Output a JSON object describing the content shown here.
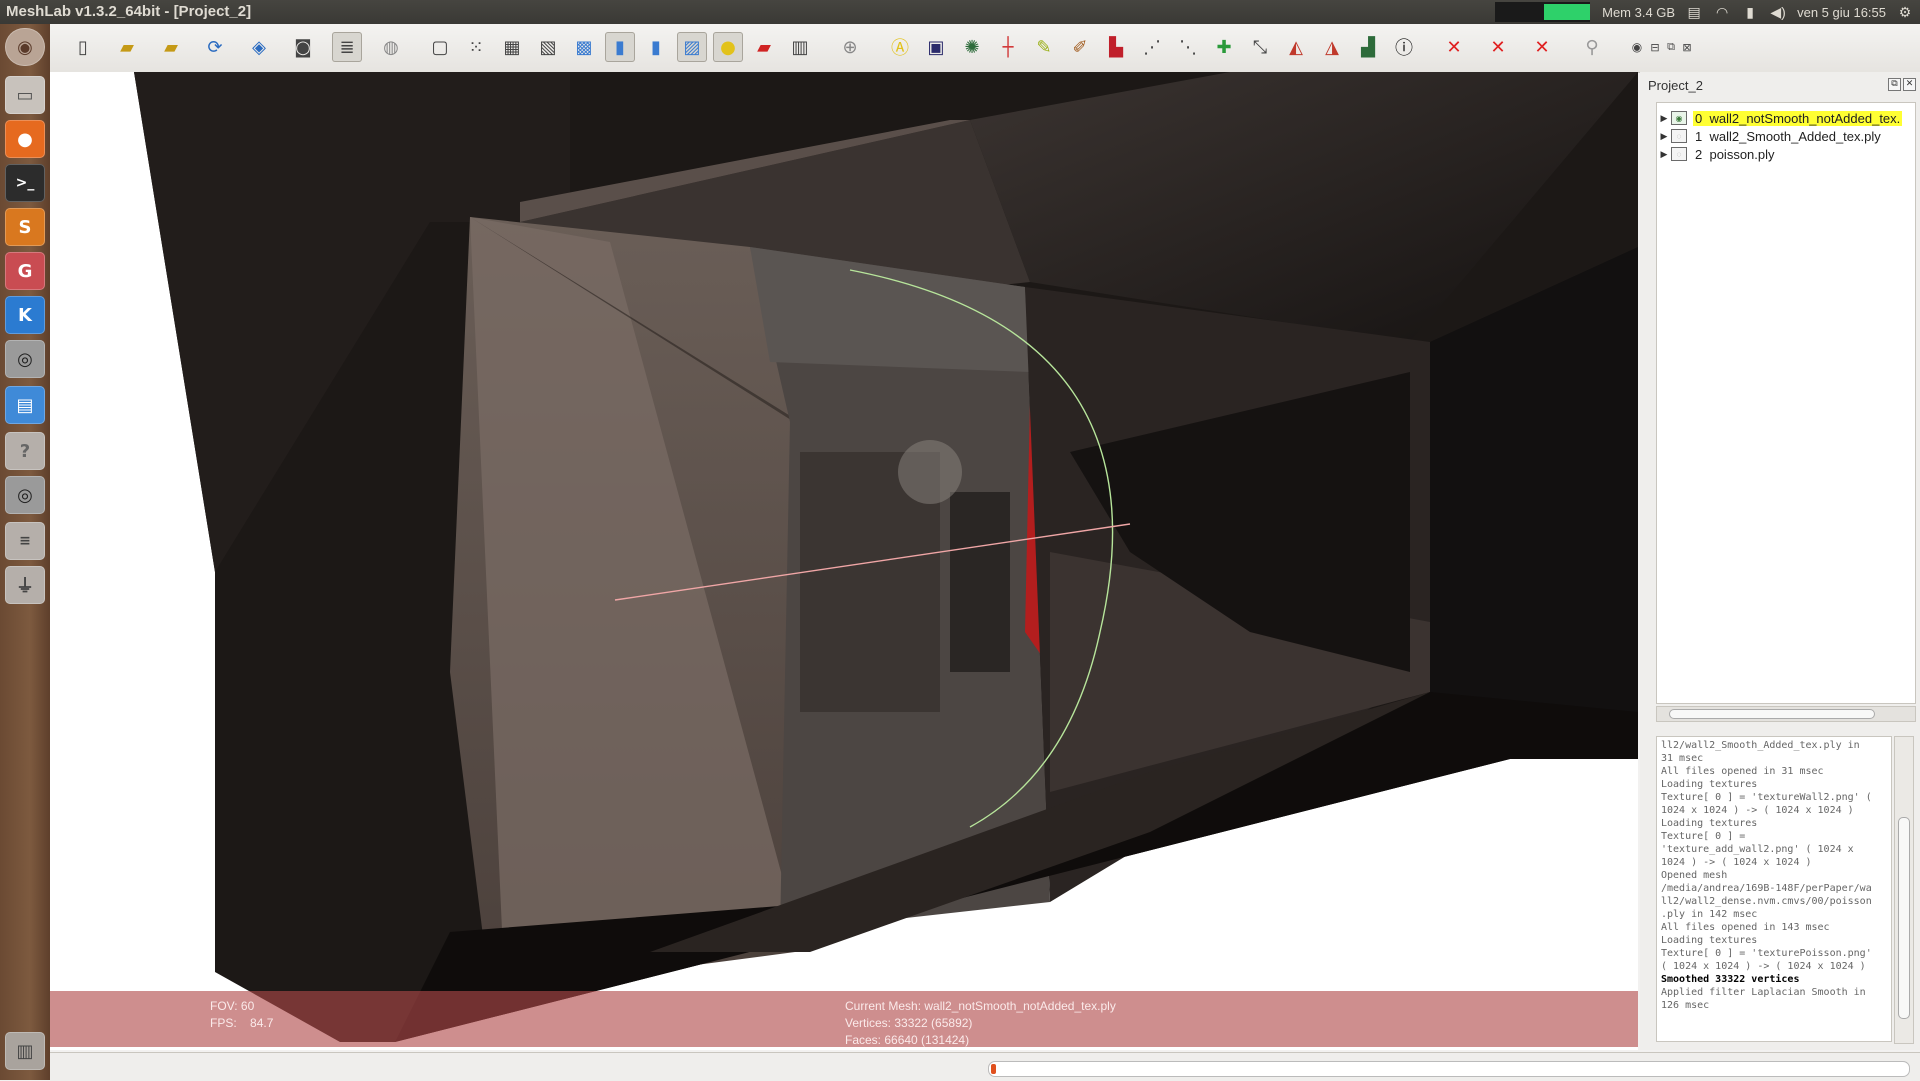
{
  "window": {
    "title": "MeshLab v1.3.2_64bit - [Project_2]"
  },
  "system_tray": {
    "memory": "Mem 3.4 GB",
    "datetime": "ven 5 giu 16:55"
  },
  "viewport_info": {
    "fov": "FOV: 60",
    "fps_label": "FPS:",
    "fps_value": "84.7",
    "current_mesh": "Current Mesh: wall2_notSmooth_notAdded_tex.ply",
    "vertices": "Vertices: 33322 (65892)",
    "faces": "Faces: 66640 (131424)"
  },
  "layer_dialog": {
    "title": "Project_2",
    "layers": [
      {
        "index": "0",
        "name": "wall2_notSmooth_notAdded_tex.",
        "selected": true,
        "visible": true
      },
      {
        "index": "1",
        "name": "wall2_Smooth_Added_tex.ply",
        "selected": false,
        "visible": false
      },
      {
        "index": "2",
        "name": "poisson.ply",
        "selected": false,
        "visible": false
      }
    ]
  },
  "log": [
    {
      "text": "ll2/wall2_Smooth_Added_tex.ply in",
      "bold": false
    },
    {
      "text": "31 msec",
      "bold": false
    },
    {
      "text": "All files opened in 31 msec",
      "bold": false
    },
    {
      "text": "Loading textures",
      "bold": false
    },
    {
      "text": "Texture[ 0 ] = 'textureWall2.png' (",
      "bold": false
    },
    {
      "text": "1024 x 1024 ) -> ( 1024 x 1024 )",
      "bold": false
    },
    {
      "text": "Loading textures",
      "bold": false
    },
    {
      "text": "Texture[ 0 ] =",
      "bold": false
    },
    {
      "text": "'texture_add_wall2.png' ( 1024 x",
      "bold": false
    },
    {
      "text": "1024 ) -> ( 1024 x 1024 )",
      "bold": false
    },
    {
      "text": "Opened mesh",
      "bold": false
    },
    {
      "text": "/media/andrea/169B-148F/perPaper/wa",
      "bold": false
    },
    {
      "text": "ll2/wall2_dense.nvm.cmvs/00/poisson",
      "bold": false
    },
    {
      "text": ".ply in 142 msec",
      "bold": false
    },
    {
      "text": "All files opened in 143 msec",
      "bold": false
    },
    {
      "text": "Loading textures",
      "bold": false
    },
    {
      "text": "Texture[ 0 ] = 'texturePoisson.png'",
      "bold": false
    },
    {
      "text": "( 1024 x 1024 ) -> ( 1024 x 1024 )",
      "bold": false
    },
    {
      "text": "Smoothed 33322 vertices",
      "bold": true
    },
    {
      "text": "Applied filter Laplacian Smooth in",
      "bold": false
    },
    {
      "text": "126 msec",
      "bold": false
    }
  ],
  "toolbar_icons": [
    "new-project-icon",
    "open-project-icon",
    "import-mesh-icon",
    "reload-icon",
    "export-mesh-icon",
    "snapshot-icon",
    "layers-icon",
    "trackball-icon",
    "bbox-icon",
    "points-icon",
    "wireframe-icon",
    "hidden-lines-icon",
    "flat-lines-icon",
    "flat-icon",
    "smooth-icon",
    "texture-icon",
    "light-icon",
    "double-light-icon",
    "fancy-light-icon",
    "axis-icon",
    "annotation-icon",
    "render-icon",
    "colorize-icon",
    "measure-icon",
    "pick-points-icon",
    "paint-icon",
    "select-faces-icon",
    "select-vertices-icon",
    "select-connected-icon",
    "manipulator-icon",
    "align-icon",
    "raster-icon",
    "quality-map-icon",
    "info-icon",
    "delete-faces-icon",
    "delete-vertices-icon",
    "delete-all-icon",
    "search-icon"
  ],
  "launcher_apps": [
    "dash-icon",
    "files-icon",
    "firefox-icon",
    "terminal-icon",
    "sublime-icon",
    "app-icon",
    "kde-icon",
    "eye-app-icon",
    "writer-icon",
    "help-icon",
    "eye-app-icon-2",
    "config-icon",
    "usb-icon",
    "trash-icon"
  ],
  "progress": 0.005
}
